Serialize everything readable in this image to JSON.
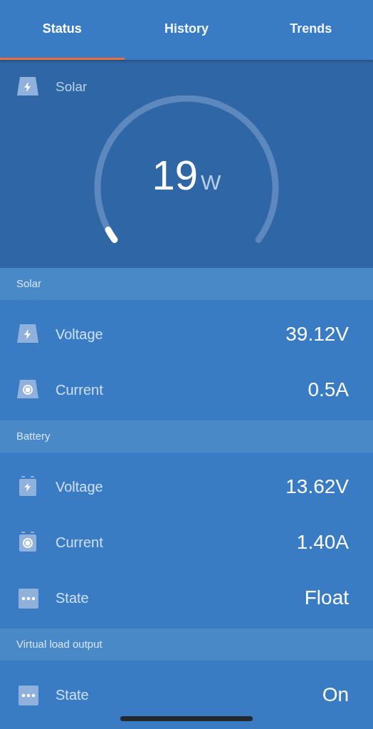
{
  "tabs": [
    {
      "label": "Status",
      "selected": true
    },
    {
      "label": "History",
      "selected": false
    },
    {
      "label": "Trends",
      "selected": false
    }
  ],
  "gauge": {
    "title": "Solar",
    "kind": "solar_bolt",
    "value": "19",
    "unit": "W"
  },
  "sections": [
    {
      "title": "Solar",
      "rows": [
        {
          "kind": "solar_bolt",
          "label": "Voltage",
          "value": "39.12V"
        },
        {
          "kind": "solar_dot",
          "label": "Current",
          "value": "0.5A"
        }
      ]
    },
    {
      "title": "Battery",
      "rows": [
        {
          "kind": "battery_bolt",
          "label": "Voltage",
          "value": "13.62V"
        },
        {
          "kind": "battery_dot",
          "label": "Current",
          "value": "1.40A"
        },
        {
          "kind": "dots",
          "label": "State",
          "value": "Float"
        }
      ]
    },
    {
      "title": "Virtual load output",
      "rows": [
        {
          "kind": "dots",
          "label": "State",
          "value": "On"
        }
      ]
    }
  ]
}
